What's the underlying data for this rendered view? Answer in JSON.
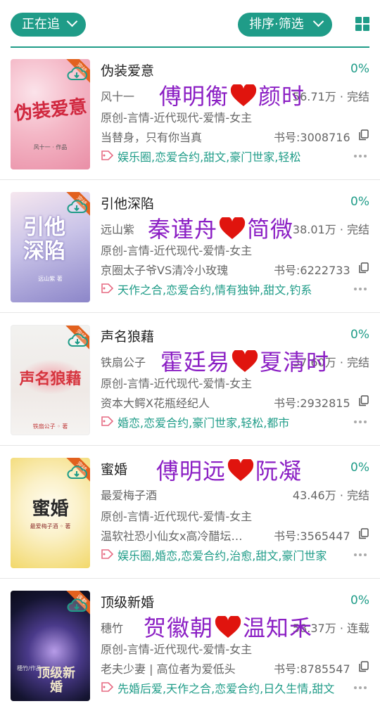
{
  "header": {
    "filter_label": "正在追",
    "sort_label": "排序·筛选"
  },
  "books": [
    {
      "title": "伪装爱意",
      "author": "风十一",
      "progress": "0%",
      "stats": "56.71万 · 完结",
      "genre": "原创-言情-近代现代-爱情-女主",
      "desc": "当替身，只有你当真",
      "book_no": "书号:3008716",
      "tags": "娱乐圈,恋爱合约,甜文,豪门世家,轻松",
      "cover_title": "伪装爱意",
      "cover_author": "风十一 · 作品",
      "cover_badge": "完结",
      "overlay_left": "傅明衡",
      "overlay_right": "颜时"
    },
    {
      "title": "引他深陷",
      "author": "远山紫",
      "progress": "0%",
      "stats": "38.01万 · 完结",
      "genre": "原创-言情-近代现代-爱情-女主",
      "desc": "京圈太子爷VS清冷小玫瑰",
      "book_no": "书号:6222733",
      "tags": "天作之合,恋爱合约,情有独钟,甜文,钓系",
      "cover_title": "引他深陷",
      "cover_author": "远山紫 著",
      "cover_badge": "完结",
      "overlay_left": "秦谨舟",
      "overlay_right": "简微"
    },
    {
      "title": "声名狼藉",
      "author": "铁扇公子",
      "progress": "0%",
      "stats": "37.60万 · 完结",
      "genre": "原创-言情-近代现代-爱情-女主",
      "desc": "资本大鳄X花瓶经纪人",
      "book_no": "书号:2932815",
      "tags": "婚恋,恋爱合约,豪门世家,轻松,都市",
      "cover_title": "声名狼藉",
      "cover_author": "铁扇公子 ◦ 著",
      "cover_badge": "完结",
      "overlay_left": "霍廷易",
      "overlay_right": "夏清时"
    },
    {
      "title": "蜜婚",
      "author": "最爱梅子酒",
      "progress": "0%",
      "stats": "43.46万 · 完结",
      "genre": "原创-言情-近代现代-爱情-女主",
      "desc": "温软社恐小仙女x高冷醋坛…",
      "book_no": "书号:3565447",
      "tags": "娱乐圈,婚恋,恋爱合约,治愈,甜文,豪门世家",
      "cover_title": "蜜婚",
      "cover_author": "最爱梅子酒 ◦ 著",
      "cover_badge": "完结",
      "overlay_left": "傅明远",
      "overlay_right": "阮凝"
    },
    {
      "title": "顶级新婚",
      "author": "穗竹",
      "progress": "0%",
      "stats": "58.37万 · 连载",
      "genre": "原创-言情-近代现代-爱情-女主",
      "desc": "老夫少妻 | 高位者为爱低头",
      "book_no": "书号:8785547",
      "tags": "先婚后爱,天作之合,恋爱合约,日久生情,甜文",
      "cover_title": "顶级新婚",
      "cover_author": "穗竹/作品",
      "cover_badge": "连载",
      "overlay_left": "贺徽朝",
      "overlay_right": "温知禾"
    }
  ],
  "colors": {
    "accent": "#1f9c88",
    "overlay_text": "#8b1fc4",
    "heart": "#e0140e",
    "badge": "#e2611e"
  },
  "icons": [
    "chevron-down-icon",
    "grid-view-icon",
    "cloud-download-icon",
    "copy-icon",
    "tag-icon",
    "more-icon",
    "heart-icon"
  ]
}
